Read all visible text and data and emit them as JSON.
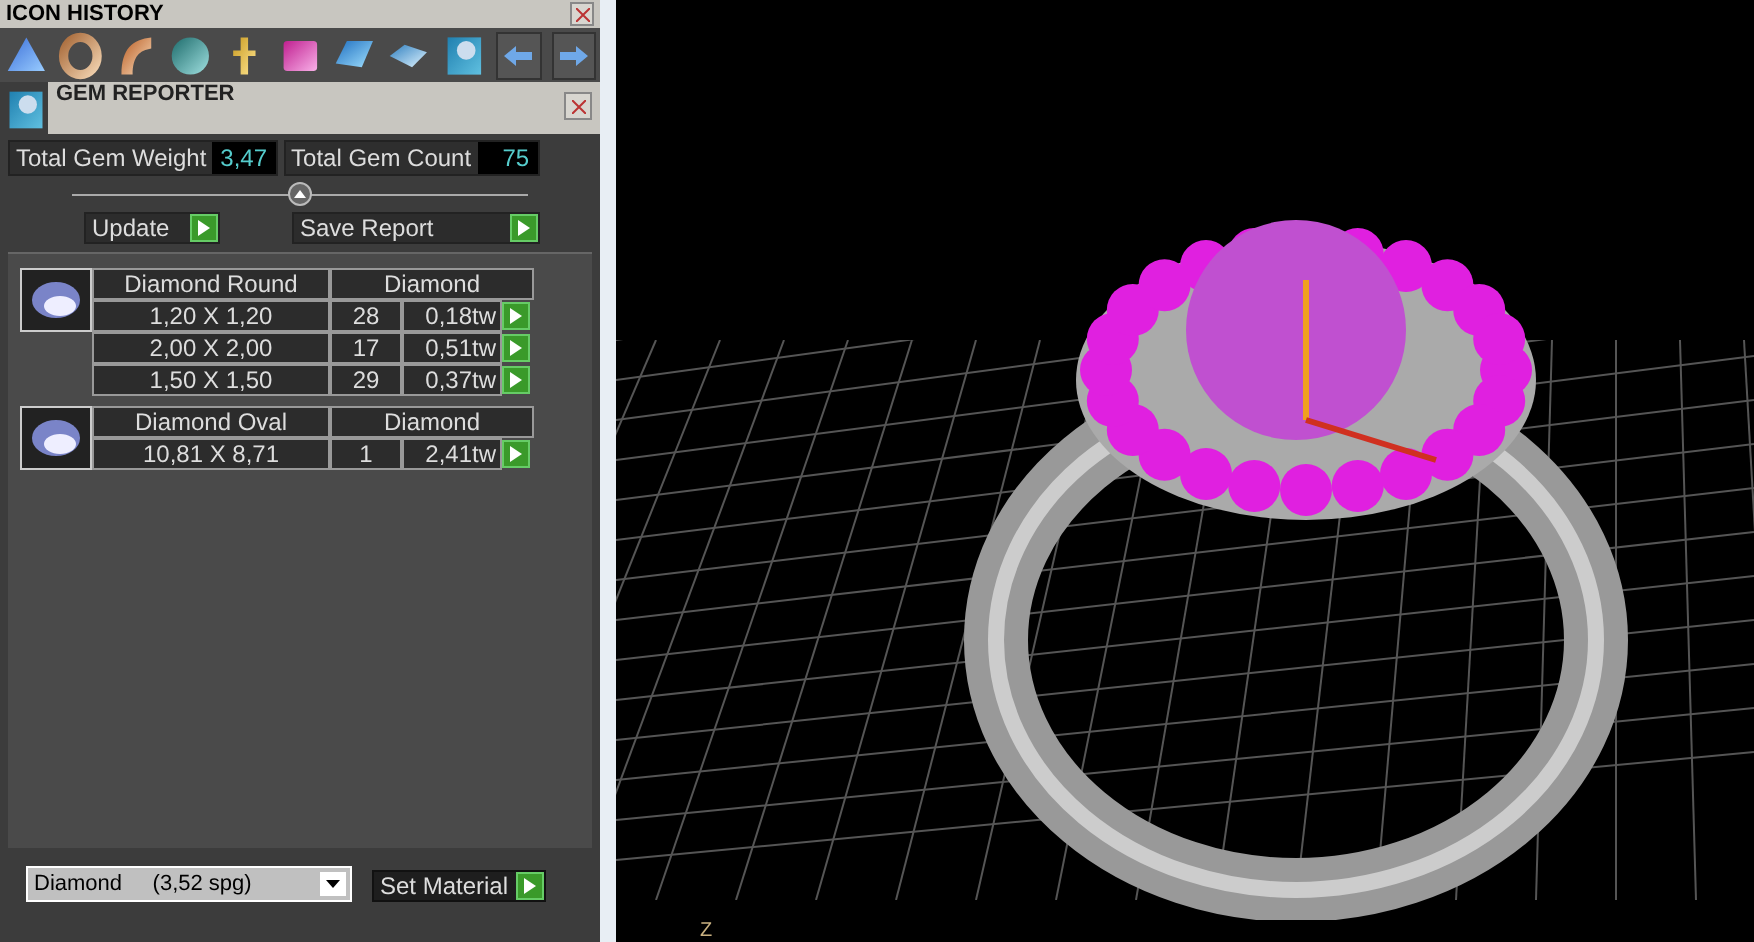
{
  "icon_history": {
    "title": "ICON HISTORY"
  },
  "gem_reporter": {
    "title": "GEM REPORTER",
    "totals": [
      {
        "label": "Total Gem Weight",
        "value": "3,47"
      },
      {
        "label": "Total Gem Count",
        "value": "75"
      }
    ],
    "buttons": [
      "Update",
      "Save Report"
    ],
    "groups": [
      {
        "shape": "Diamond Round",
        "material": "Diamond",
        "rows": [
          {
            "size": "1,20 X 1,20",
            "count": "28",
            "weight": "0,18tw"
          },
          {
            "size": "2,00 X 2,00",
            "count": "17",
            "weight": "0,51tw"
          },
          {
            "size": "1,50 X 1,50",
            "count": "29",
            "weight": "0,37tw"
          }
        ]
      },
      {
        "shape": "Diamond Oval",
        "material": "Diamond",
        "rows": [
          {
            "size": "10,81 X 8,71",
            "count": "1",
            "weight": "2,41tw"
          }
        ]
      }
    ],
    "material_select": {
      "value": "Diamond     (3,52 spg)"
    },
    "set_material": "Set Material"
  },
  "viewport": {
    "axis_label": "Z"
  }
}
